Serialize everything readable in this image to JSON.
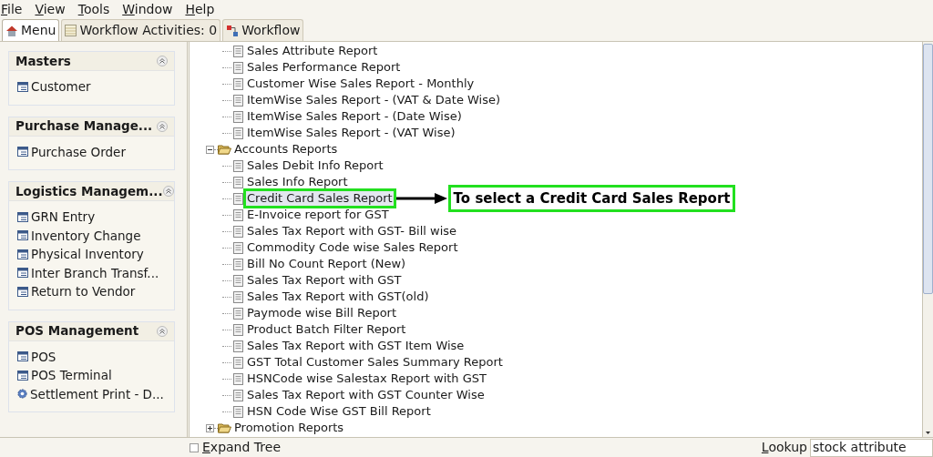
{
  "menu_bar": [
    "File",
    "View",
    "Tools",
    "Window",
    "Help"
  ],
  "tabs": [
    {
      "label": "Menu",
      "kind": "home",
      "selected": true
    },
    {
      "label": "Workflow Activities: 0",
      "kind": "table",
      "selected": false
    },
    {
      "label": "Workflow",
      "kind": "workflow",
      "selected": false
    }
  ],
  "sidebar": {
    "panels": [
      {
        "title": "Masters",
        "items": [
          {
            "label": "Customer",
            "kind": "form"
          }
        ]
      },
      {
        "title": "Purchase Manage...",
        "items": [
          {
            "label": "Purchase Order",
            "kind": "form"
          }
        ]
      },
      {
        "title": "Logistics Managem...",
        "items": [
          {
            "label": "GRN Entry",
            "kind": "form"
          },
          {
            "label": "Inventory Change",
            "kind": "form"
          },
          {
            "label": "Physical Inventory",
            "kind": "form"
          },
          {
            "label": "Inter Branch Transf...",
            "kind": "form"
          },
          {
            "label": "Return to Vendor",
            "kind": "form"
          }
        ]
      },
      {
        "title": "POS Management",
        "items": [
          {
            "label": "POS",
            "kind": "form"
          },
          {
            "label": "POS Terminal",
            "kind": "form"
          },
          {
            "label": "Settlement Print - D...",
            "kind": "gear"
          }
        ]
      }
    ]
  },
  "tree": {
    "items": [
      {
        "label": "Sales Attribute Report",
        "selected": false
      },
      {
        "label": "Sales Performance Report",
        "selected": false
      },
      {
        "label": "Customer Wise Sales Report - Monthly",
        "selected": false
      },
      {
        "label": "ItemWise Sales Report - (VAT & Date Wise)",
        "selected": false
      },
      {
        "label": "ItemWise Sales Report - (Date Wise)",
        "selected": false
      },
      {
        "label": "ItemWise Sales Report - (VAT Wise)",
        "selected": false
      }
    ],
    "folders": [
      {
        "label": "Accounts Reports",
        "expanded": true,
        "children": [
          {
            "label": "Sales Debit Info Report",
            "selected": false
          },
          {
            "label": "Sales Info Report",
            "selected": false
          },
          {
            "label": "Credit Card Sales Report",
            "selected": true,
            "callout": "To select a Credit Card Sales Report"
          },
          {
            "label": "E-Invoice report for GST",
            "selected": false
          },
          {
            "label": "Sales Tax Report with GST- Bill wise",
            "selected": false
          },
          {
            "label": "Commodity Code wise Sales Report",
            "selected": false
          },
          {
            "label": "Bill No Count Report (New)",
            "selected": false
          },
          {
            "label": "Sales Tax Report with GST",
            "selected": false
          },
          {
            "label": "Sales Tax Report with GST(old)",
            "selected": false
          },
          {
            "label": "Paymode wise Bill Report",
            "selected": false
          },
          {
            "label": "Product Batch Filter Report",
            "selected": false
          },
          {
            "label": "Sales Tax Report with GST Item Wise",
            "selected": false
          },
          {
            "label": "GST Total Customer Sales Summary Report",
            "selected": false
          },
          {
            "label": "HSNCode wise Salestax Report with GST",
            "selected": false
          },
          {
            "label": "Sales Tax Report with GST Counter Wise",
            "selected": false
          },
          {
            "label": "HSN Code Wise GST Bill Report",
            "selected": false
          }
        ]
      },
      {
        "label": "Promotion Reports",
        "expanded": false
      }
    ]
  },
  "bottom_bar": {
    "expand_tree": {
      "label": "Expand Tree",
      "checked": false
    },
    "lookup": {
      "label": "Lookup",
      "value": "stock attribute"
    }
  }
}
